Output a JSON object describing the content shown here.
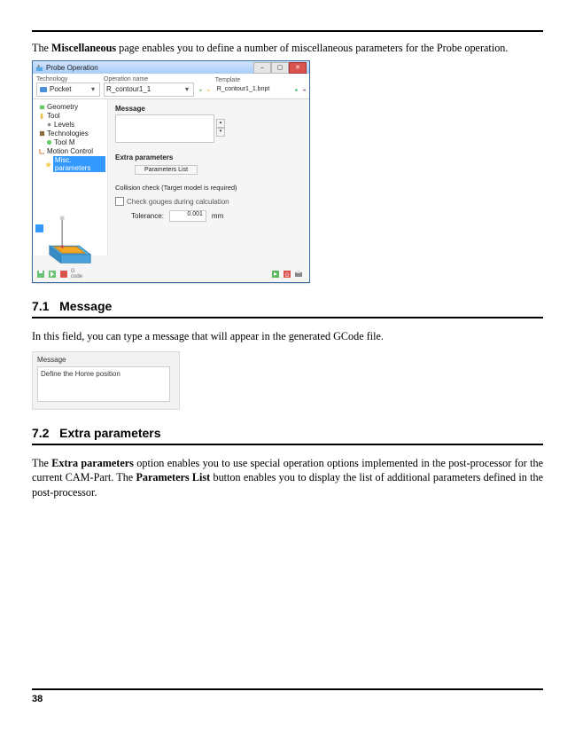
{
  "intro": {
    "pre": "The ",
    "bold": "Miscellaneous",
    "post": " page enables you to define a number of miscellaneous parameters for the Probe operation."
  },
  "dialog": {
    "title": "Probe Operation",
    "toolbar": {
      "technology_lbl": "Technology",
      "technology_value": "Pocket",
      "opname_lbl": "Operation name",
      "opname_value": "R_contour1_1",
      "template_lbl": "Template",
      "template_value": "R_contour1_1.bnpt"
    },
    "tree": [
      {
        "indent": 0,
        "label": "Geometry",
        "icon": "cube-green"
      },
      {
        "indent": 0,
        "label": "Tool",
        "icon": "tool-yellow"
      },
      {
        "indent": 1,
        "label": "Levels",
        "icon": "dot"
      },
      {
        "indent": 0,
        "label": "Technologies",
        "icon": "tech"
      },
      {
        "indent": 1,
        "label": "Tool M",
        "icon": "gear-green"
      },
      {
        "indent": 0,
        "label": "Motion Control",
        "icon": "axes"
      },
      {
        "indent": 1,
        "label": "Misc. parameters",
        "icon": "star-yellow",
        "selected": true
      }
    ],
    "pane": {
      "message_lbl": "Message",
      "extra_lbl": "Extra parameters",
      "params_btn": "Parameters List",
      "coll_lbl": "Collision check (Target model is required)",
      "gouge_lbl": "Check gouges during calculation",
      "tol_lbl": "Tolerance:",
      "tol_val": "0.001",
      "tol_unit": "mm"
    }
  },
  "section1": {
    "num": "7.1",
    "title": "Message",
    "body": "In this field, you can type a message that will appear in the generated GCode file."
  },
  "sample": {
    "label": "Message",
    "text": "Define the Home position"
  },
  "section2": {
    "num": "7.2",
    "title": "Extra parameters",
    "body_pre": "The ",
    "body_b1": "Extra parameters",
    "body_mid": " option enables you to use special operation options implemented in the post-processor for the current CAM-Part. The ",
    "body_b2": "Parameters List",
    "body_post": " button enables you to display the list of additional parameters defined in the post-processor."
  },
  "page": "38"
}
